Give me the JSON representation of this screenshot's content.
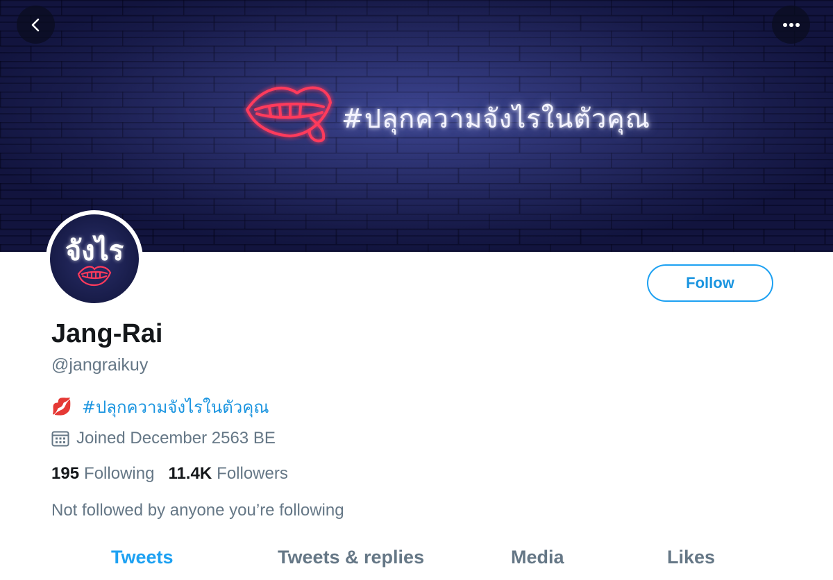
{
  "banner": {
    "neon_text": "#ปลุกความจังไรในตัวคุณ",
    "background_color": "#1b1f55",
    "neon_color": "#ff2a55"
  },
  "nav": {
    "back_icon": "chevron-left-icon",
    "more_icon": "more-horizontal-icon"
  },
  "avatar": {
    "text": "จังไร"
  },
  "follow_button": {
    "label": "Follow"
  },
  "profile": {
    "name": "Jang-Rai",
    "handle": "@jangraikuy",
    "bio_emoji": "💋",
    "bio_hashtag": "#ปลุกความจังไรในตัวคุณ",
    "joined": "Joined December 2563 BE",
    "following_count": "195",
    "following_label": "Following",
    "followers_count": "11.4K",
    "followers_label": "Followers",
    "not_followed": "Not followed by anyone you’re following"
  },
  "tabs": [
    {
      "label": "Tweets",
      "active": true
    },
    {
      "label": "Tweets & replies",
      "active": false
    },
    {
      "label": "Media",
      "active": false
    },
    {
      "label": "Likes",
      "active": false
    }
  ],
  "colors": {
    "accent": "#1da1f2",
    "text_primary": "#14171a",
    "text_secondary": "#657786"
  }
}
